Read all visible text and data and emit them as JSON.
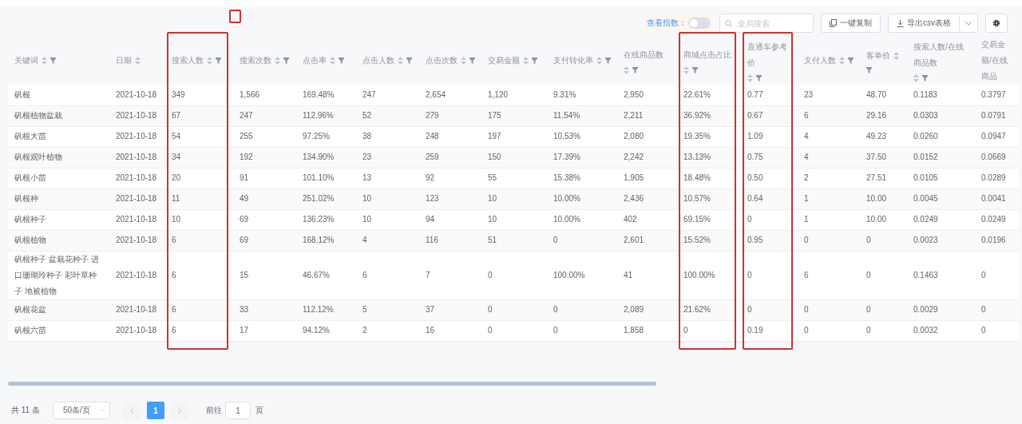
{
  "toolbar": {
    "annotation_marker": true,
    "index_toggle": {
      "label": "查看指数：",
      "on": false
    },
    "search": {
      "placeholder": "全局搜索"
    },
    "copy_button": "一键复制",
    "export_button": "导出csv表格"
  },
  "table": {
    "columns": [
      {
        "label": "关键词",
        "sort": true,
        "filter": true,
        "highlighted": false
      },
      {
        "label": "日期",
        "sort": true,
        "filter": false,
        "highlighted": false
      },
      {
        "label": "搜索人数",
        "sort": true,
        "filter": true,
        "highlighted": true
      },
      {
        "label": "搜索次数",
        "sort": true,
        "filter": true,
        "highlighted": false
      },
      {
        "label": "点击率",
        "sort": true,
        "filter": true,
        "highlighted": false
      },
      {
        "label": "点击人数",
        "sort": true,
        "filter": true,
        "highlighted": false
      },
      {
        "label": "点击次数",
        "sort": true,
        "filter": true,
        "highlighted": false
      },
      {
        "label": "交易金额",
        "sort": true,
        "filter": true,
        "highlighted": false
      },
      {
        "label": "支付转化率",
        "sort": true,
        "filter": true,
        "highlighted": false
      },
      {
        "label": "在线商品数",
        "sort": true,
        "filter": true,
        "highlighted": false
      },
      {
        "label": "商城点击占比",
        "sort": true,
        "filter": true,
        "highlighted": true
      },
      {
        "label": "直通车参考价",
        "sort": true,
        "filter": true,
        "highlighted": true
      },
      {
        "label": "支付人数",
        "sort": true,
        "filter": true,
        "highlighted": false
      },
      {
        "label": "客单价",
        "sort": true,
        "filter": true,
        "highlighted": false
      },
      {
        "label": "搜索人数/在线商品数",
        "sort": true,
        "filter": true,
        "highlighted": false
      },
      {
        "label": "交易金额/在线商品",
        "sort": false,
        "filter": false,
        "highlighted": false
      }
    ],
    "rows": [
      [
        "矾根",
        "2021-10-18",
        "349",
        "1,566",
        "169.48%",
        "247",
        "2,654",
        "1,120",
        "9.31%",
        "2,950",
        "22.61%",
        "0.77",
        "23",
        "48.70",
        "0.1183",
        "0.3797"
      ],
      [
        "矾根植物盆栽",
        "2021-10-18",
        "67",
        "247",
        "112.96%",
        "52",
        "279",
        "175",
        "11.54%",
        "2,211",
        "36.92%",
        "0.67",
        "6",
        "29.16",
        "0.0303",
        "0.0791"
      ],
      [
        "矾根大苗",
        "2021-10-18",
        "54",
        "255",
        "97.25%",
        "38",
        "248",
        "197",
        "10.53%",
        "2,080",
        "19.35%",
        "1.09",
        "4",
        "49.23",
        "0.0260",
        "0.0947"
      ],
      [
        "矾根观叶植物",
        "2021-10-18",
        "34",
        "192",
        "134.90%",
        "23",
        "259",
        "150",
        "17.39%",
        "2,242",
        "13.13%",
        "0.75",
        "4",
        "37.50",
        "0.0152",
        "0.0669"
      ],
      [
        "矾根小苗",
        "2021-10-18",
        "20",
        "91",
        "101.10%",
        "13",
        "92",
        "55",
        "15.38%",
        "1,905",
        "18.48%",
        "0.50",
        "2",
        "27.51",
        "0.0105",
        "0.0289"
      ],
      [
        "矾根种",
        "2021-10-18",
        "11",
        "49",
        "251.02%",
        "10",
        "123",
        "10",
        "10.00%",
        "2,436",
        "10.57%",
        "0.64",
        "1",
        "10.00",
        "0.0045",
        "0.0041"
      ],
      [
        "矾根种子",
        "2021-10-18",
        "10",
        "69",
        "136.23%",
        "10",
        "94",
        "10",
        "10.00%",
        "402",
        "69.15%",
        "0",
        "1",
        "10.00",
        "0.0249",
        "0.0249"
      ],
      [
        "矾根植物",
        "2021-10-18",
        "6",
        "69",
        "168.12%",
        "4",
        "116",
        "51",
        "0",
        "2,601",
        "15.52%",
        "0.95",
        "0",
        "0",
        "0.0023",
        "0.0196"
      ],
      [
        "矾根种子 盆栽花种子 进口珊瑚玲种子 彩叶草种子 地被植物",
        "2021-10-18",
        "6",
        "15",
        "46.67%",
        "6",
        "7",
        "0",
        "100.00%",
        "41",
        "100.00%",
        "0",
        "6",
        "0",
        "0.1463",
        "0"
      ],
      [
        "矾根花盆",
        "2021-10-18",
        "6",
        "33",
        "112.12%",
        "5",
        "37",
        "0",
        "0",
        "2,089",
        "21.62%",
        "0",
        "0",
        "0",
        "0.0029",
        "0"
      ],
      [
        "矾根六苗",
        "2021-10-18",
        "6",
        "17",
        "94.12%",
        "2",
        "16",
        "0",
        "0",
        "1,858",
        "0",
        "0.19",
        "0",
        "0",
        "0.0032",
        "0"
      ]
    ]
  },
  "pagination": {
    "total": "共 11 条",
    "page_size": "50条/页",
    "pages": [
      {
        "label": "1",
        "selected": true
      }
    ],
    "goto_label": "前往",
    "goto_value": "1",
    "goto_suffix": "页"
  }
}
